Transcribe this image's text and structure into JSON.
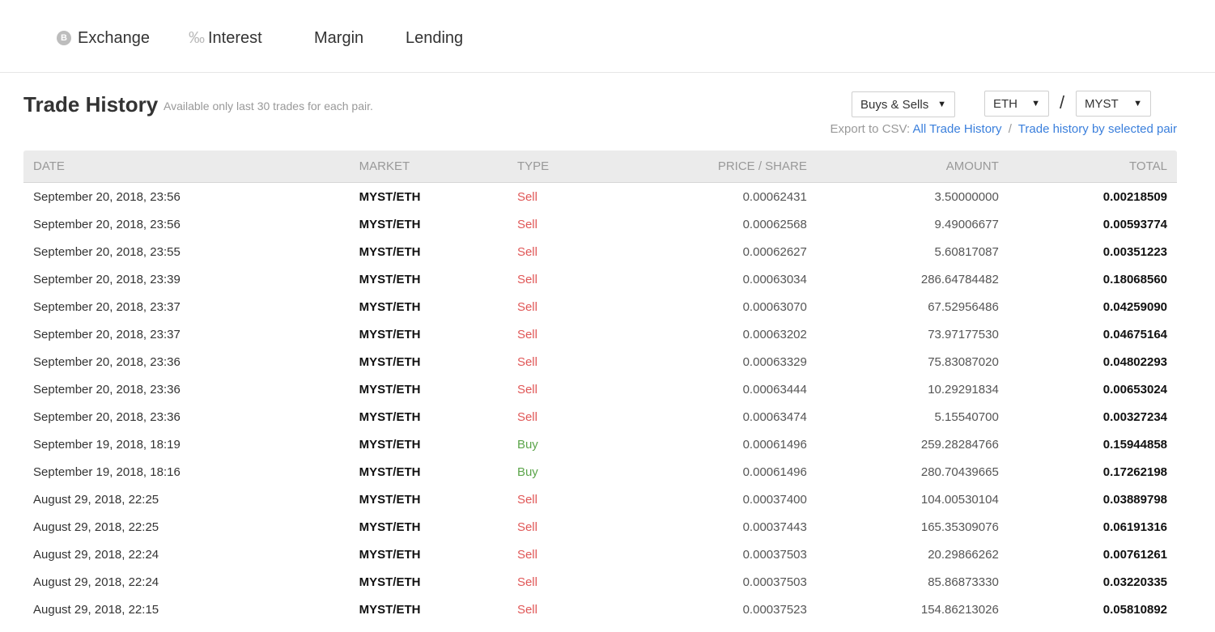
{
  "nav": {
    "items": [
      {
        "label": "Exchange",
        "icon": "bitcoin-coin-icon"
      },
      {
        "label": "Interest",
        "icon": "percent-icon"
      },
      {
        "label": "Margin"
      },
      {
        "label": "Lending"
      }
    ]
  },
  "page": {
    "title": "Trade History",
    "subtitle": "Available only last 30 trades for each pair."
  },
  "filters": {
    "type_select": "Buys & Sells",
    "base_select": "ETH",
    "separator": "/",
    "quote_select": "MYST"
  },
  "export": {
    "label": "Export to CSV:",
    "all_link": "All Trade History",
    "separator": "/",
    "pair_link": "Trade history by selected pair"
  },
  "table": {
    "headers": [
      "Date",
      "Market",
      "Type",
      "Price / Share",
      "Amount",
      "Total"
    ],
    "rows": [
      {
        "date": "September 20, 2018, 23:56",
        "market": "MYST/ETH",
        "type": "Sell",
        "price": "0.00062431",
        "amount": "3.50000000",
        "total": "0.00218509"
      },
      {
        "date": "September 20, 2018, 23:56",
        "market": "MYST/ETH",
        "type": "Sell",
        "price": "0.00062568",
        "amount": "9.49006677",
        "total": "0.00593774"
      },
      {
        "date": "September 20, 2018, 23:55",
        "market": "MYST/ETH",
        "type": "Sell",
        "price": "0.00062627",
        "amount": "5.60817087",
        "total": "0.00351223"
      },
      {
        "date": "September 20, 2018, 23:39",
        "market": "MYST/ETH",
        "type": "Sell",
        "price": "0.00063034",
        "amount": "286.64784482",
        "total": "0.18068560"
      },
      {
        "date": "September 20, 2018, 23:37",
        "market": "MYST/ETH",
        "type": "Sell",
        "price": "0.00063070",
        "amount": "67.52956486",
        "total": "0.04259090"
      },
      {
        "date": "September 20, 2018, 23:37",
        "market": "MYST/ETH",
        "type": "Sell",
        "price": "0.00063202",
        "amount": "73.97177530",
        "total": "0.04675164"
      },
      {
        "date": "September 20, 2018, 23:36",
        "market": "MYST/ETH",
        "type": "Sell",
        "price": "0.00063329",
        "amount": "75.83087020",
        "total": "0.04802293"
      },
      {
        "date": "September 20, 2018, 23:36",
        "market": "MYST/ETH",
        "type": "Sell",
        "price": "0.00063444",
        "amount": "10.29291834",
        "total": "0.00653024"
      },
      {
        "date": "September 20, 2018, 23:36",
        "market": "MYST/ETH",
        "type": "Sell",
        "price": "0.00063474",
        "amount": "5.15540700",
        "total": "0.00327234"
      },
      {
        "date": "September 19, 2018, 18:19",
        "market": "MYST/ETH",
        "type": "Buy",
        "price": "0.00061496",
        "amount": "259.28284766",
        "total": "0.15944858"
      },
      {
        "date": "September 19, 2018, 18:16",
        "market": "MYST/ETH",
        "type": "Buy",
        "price": "0.00061496",
        "amount": "280.70439665",
        "total": "0.17262198"
      },
      {
        "date": "August 29, 2018, 22:25",
        "market": "MYST/ETH",
        "type": "Sell",
        "price": "0.00037400",
        "amount": "104.00530104",
        "total": "0.03889798"
      },
      {
        "date": "August 29, 2018, 22:25",
        "market": "MYST/ETH",
        "type": "Sell",
        "price": "0.00037443",
        "amount": "165.35309076",
        "total": "0.06191316"
      },
      {
        "date": "August 29, 2018, 22:24",
        "market": "MYST/ETH",
        "type": "Sell",
        "price": "0.00037503",
        "amount": "20.29866262",
        "total": "0.00761261"
      },
      {
        "date": "August 29, 2018, 22:24",
        "market": "MYST/ETH",
        "type": "Sell",
        "price": "0.00037503",
        "amount": "85.86873330",
        "total": "0.03220335"
      },
      {
        "date": "August 29, 2018, 22:15",
        "market": "MYST/ETH",
        "type": "Sell",
        "price": "0.00037523",
        "amount": "154.86213026",
        "total": "0.05810892"
      }
    ]
  },
  "colors": {
    "sell": "#e05757",
    "buy": "#5ca54b",
    "link": "#3a7fdc",
    "header_bg": "#ebebeb"
  }
}
